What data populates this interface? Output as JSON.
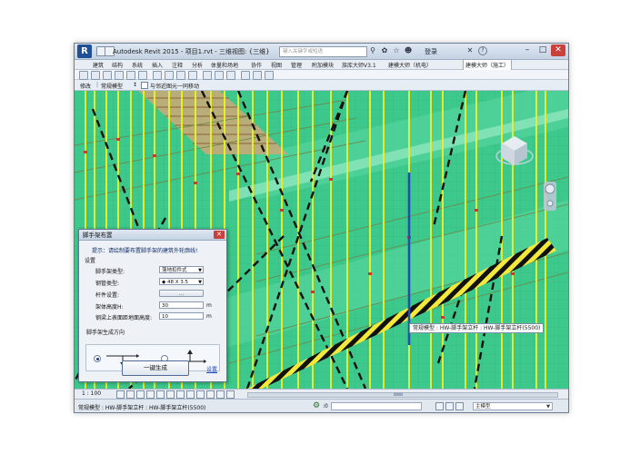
{
  "window": {
    "title": "Autodesk Revit 2015 -    项目1.rvt - 三维视图: {三维}",
    "search_placeholder": "键入关键字或短语",
    "login_label": "登录",
    "help_label": "?"
  },
  "ribbon": {
    "tabs": [
      "建筑",
      "结构",
      "系统",
      "插入",
      "注释",
      "分析",
      "体量和场地",
      "协作",
      "视图",
      "管理",
      "附加模块",
      "族库大师V3.1",
      "建模大师（机电）",
      "建模大师（施工）"
    ],
    "active_tab": "建模大师（施工）"
  },
  "options_bar": {
    "modify_label": "修改",
    "category_label": "常规模型",
    "filter_glyph": "↕",
    "checkbox_label": "与邻近图元一同移动"
  },
  "dialog": {
    "title": "脚手架布置",
    "close_glyph": "✕",
    "hint": "提示：请绘制要布置脚手架的建筑外轮廓线!",
    "settings_label": "设置",
    "type_label": "脚手架类型:",
    "type_value": "落地扣件式",
    "pipe_label": "钢管类型:",
    "pipe_value": "◆ 48 X 3.5",
    "bar_label": "杆件设置:",
    "bar_button": "...",
    "height_label": "架体高度H:",
    "height_value": "30",
    "height_unit": "m",
    "ground_label": "钢梁上表面距地面高度:",
    "ground_value": "10",
    "ground_unit": "m",
    "direction_label": "脚手架生成方向",
    "generate_button": "一键生成",
    "settings_link": "设置"
  },
  "tooltip": "常规模型 : HW-脚手架立杆 : HW-脚手架立杆(5500)",
  "viewbar": {
    "scale": "1 : 100"
  },
  "status": {
    "text": "常规模型 : HW-脚手架立杆 : HW-脚手架立杆(5500)",
    "model_field": "主模型",
    "zero_value": ":0"
  },
  "colors": {
    "canvas_green": "#3ec98c",
    "scaffold_yellow": "#e6ee2a",
    "hazard_black": "#111111",
    "selected_blue": "#1f4fb5"
  }
}
